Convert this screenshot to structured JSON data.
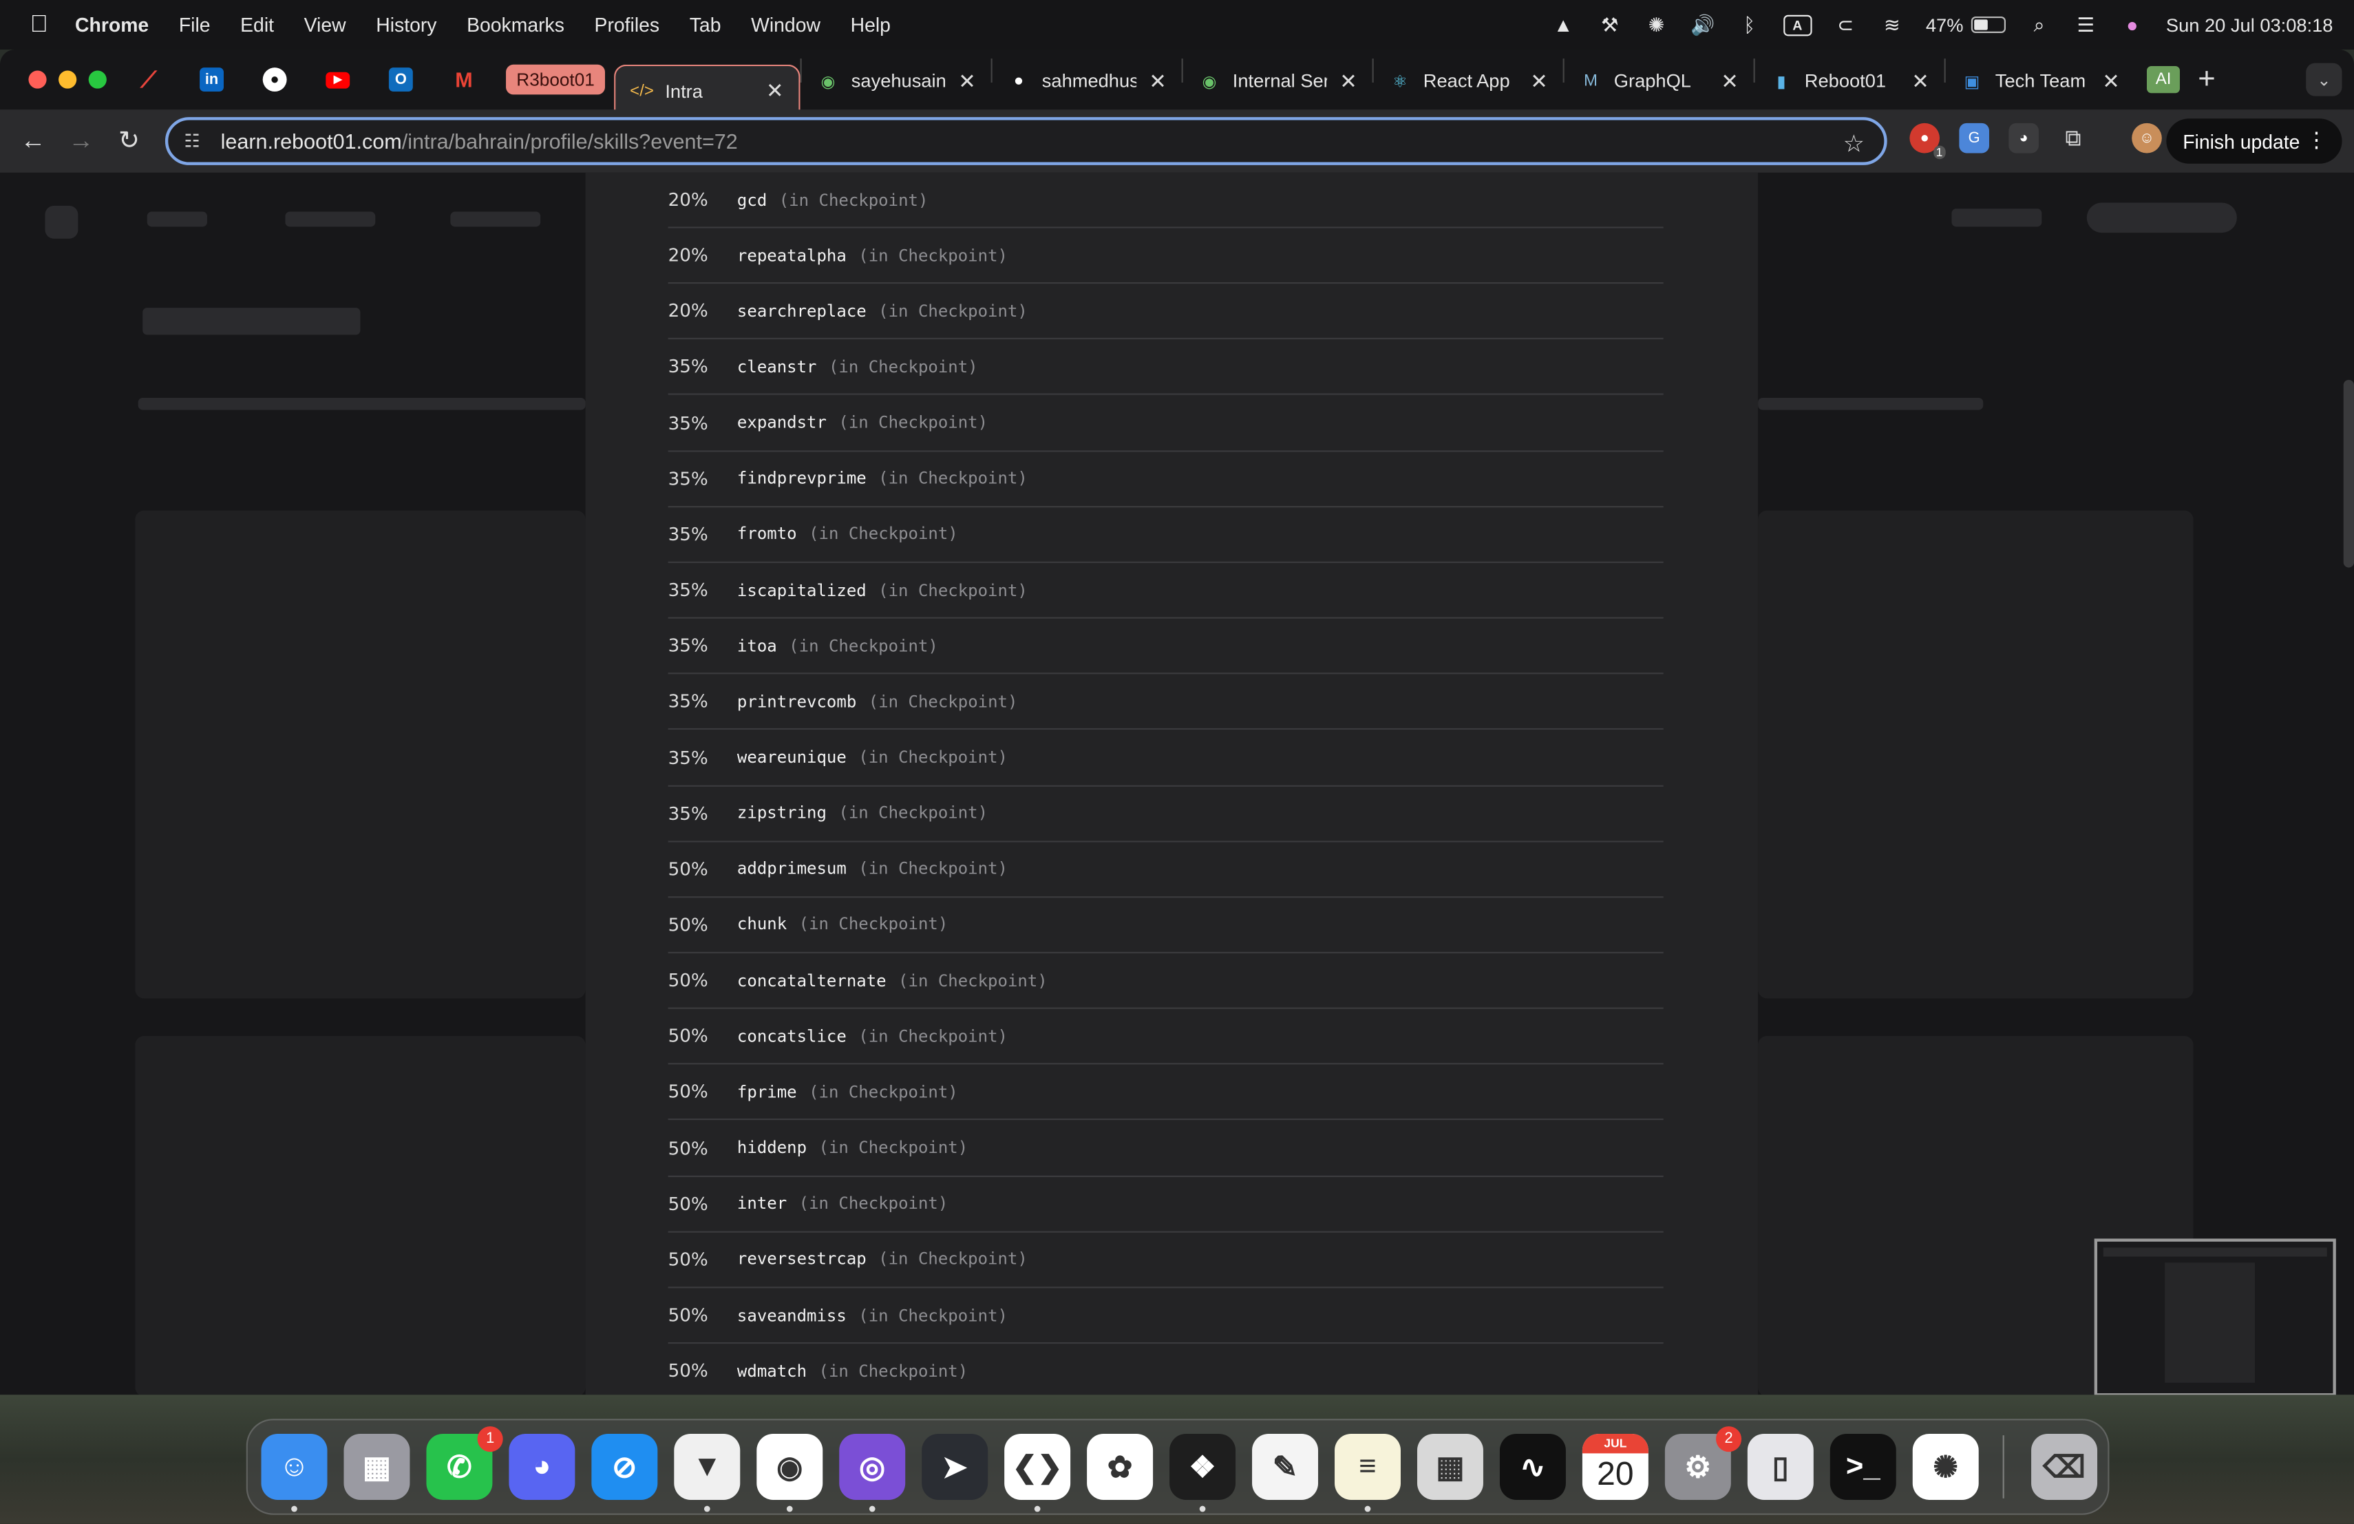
{
  "menubar": {
    "app_name": "Chrome",
    "items": [
      "File",
      "Edit",
      "View",
      "History",
      "Bookmarks",
      "Profiles",
      "Tab",
      "Window",
      "Help"
    ],
    "status": {
      "keyboard_label": "A",
      "battery_percent": "47%",
      "battery_level": 0.47,
      "datetime": "Sun 20 Jul  03:08:18"
    }
  },
  "tabs": {
    "group_label": "R3boot01",
    "items": [
      {
        "title": "Intra",
        "icon": "code-icon",
        "active": true,
        "width": 124
      },
      {
        "title": "sayehusain/",
        "icon": "watcher-icon",
        "width": 126
      },
      {
        "title": "sahmedhuss",
        "icon": "github-icon",
        "width": 126
      },
      {
        "title": "Internal Serv",
        "icon": "watcher-icon",
        "width": 126
      },
      {
        "title": "React App",
        "icon": "react-icon",
        "width": 126
      },
      {
        "title": "GraphQL",
        "icon": "graphql-icon",
        "width": 126
      },
      {
        "title": "Reboot01",
        "icon": "reboot-icon",
        "width": 126
      },
      {
        "title": "Tech Team A",
        "icon": "outlook-icon",
        "width": 126
      }
    ],
    "ai_label": "AI"
  },
  "toolbar": {
    "url_host": "learn.reboot01.com",
    "url_path": "/intra/bahrain/profile/skills?event=72",
    "ext_badge": "1",
    "finish_update": "Finish update"
  },
  "skills": [
    {
      "percent": "20%",
      "name": "gcd",
      "context": "(in Checkpoint)"
    },
    {
      "percent": "20%",
      "name": "repeatalpha",
      "context": "(in Checkpoint)"
    },
    {
      "percent": "20%",
      "name": "searchreplace",
      "context": "(in Checkpoint)"
    },
    {
      "percent": "35%",
      "name": "cleanstr",
      "context": "(in Checkpoint)"
    },
    {
      "percent": "35%",
      "name": "expandstr",
      "context": "(in Checkpoint)"
    },
    {
      "percent": "35%",
      "name": "findprevprime",
      "context": "(in Checkpoint)"
    },
    {
      "percent": "35%",
      "name": "fromto",
      "context": "(in Checkpoint)"
    },
    {
      "percent": "35%",
      "name": "iscapitalized",
      "context": "(in Checkpoint)"
    },
    {
      "percent": "35%",
      "name": "itoa",
      "context": "(in Checkpoint)"
    },
    {
      "percent": "35%",
      "name": "printrevcomb",
      "context": "(in Checkpoint)"
    },
    {
      "percent": "35%",
      "name": "weareunique",
      "context": "(in Checkpoint)"
    },
    {
      "percent": "35%",
      "name": "zipstring",
      "context": "(in Checkpoint)"
    },
    {
      "percent": "50%",
      "name": "addprimesum",
      "context": "(in Checkpoint)"
    },
    {
      "percent": "50%",
      "name": "chunk",
      "context": "(in Checkpoint)"
    },
    {
      "percent": "50%",
      "name": "concatalternate",
      "context": "(in Checkpoint)"
    },
    {
      "percent": "50%",
      "name": "concatslice",
      "context": "(in Checkpoint)"
    },
    {
      "percent": "50%",
      "name": "fprime",
      "context": "(in Checkpoint)"
    },
    {
      "percent": "50%",
      "name": "hiddenp",
      "context": "(in Checkpoint)"
    },
    {
      "percent": "50%",
      "name": "inter",
      "context": "(in Checkpoint)"
    },
    {
      "percent": "50%",
      "name": "reversestrcap",
      "context": "(in Checkpoint)"
    },
    {
      "percent": "50%",
      "name": "saveandmiss",
      "context": "(in Checkpoint)"
    },
    {
      "percent": "50%",
      "name": "wdmatch",
      "context": "(in Checkpoint)"
    }
  ],
  "dock": {
    "apps": [
      {
        "name": "finder",
        "icon": "finder-icon",
        "color": "#3a8ef0",
        "glyph": "☺",
        "running": true
      },
      {
        "name": "launchpad",
        "icon": "launchpad-icon",
        "color": "#9a9aa2",
        "glyph": "▦",
        "running": false
      },
      {
        "name": "whatsapp",
        "icon": "whatsapp-icon",
        "color": "#27c24c",
        "glyph": "✆",
        "badge": "1",
        "running": false
      },
      {
        "name": "discord",
        "icon": "discord-icon",
        "color": "#5865f2",
        "glyph": "◕",
        "running": false
      },
      {
        "name": "safari",
        "icon": "safari-icon",
        "color": "#1f8ef1",
        "glyph": "⊘",
        "running": false
      },
      {
        "name": "brave",
        "icon": "brave-icon",
        "color": "#f0f0f0",
        "glyph": "▼",
        "running": true
      },
      {
        "name": "chrome",
        "icon": "chrome-icon",
        "color": "#ffffff",
        "glyph": "◉",
        "running": true
      },
      {
        "name": "github-desktop",
        "icon": "github-desktop-icon",
        "color": "#7b4fd6",
        "glyph": "◎",
        "running": true
      },
      {
        "name": "send",
        "icon": "send-icon",
        "color": "#2a2d33",
        "glyph": "➤",
        "running": false
      },
      {
        "name": "vscode",
        "icon": "vscode-icon",
        "color": "#ffffff",
        "glyph": "❮❯",
        "running": true
      },
      {
        "name": "photos",
        "icon": "photos-icon",
        "color": "#ffffff",
        "glyph": "✿",
        "running": false
      },
      {
        "name": "figma",
        "icon": "figma-icon",
        "color": "#1e1e1e",
        "glyph": "❖",
        "running": true
      },
      {
        "name": "freeform",
        "icon": "freeform-icon",
        "color": "#f4f4f4",
        "glyph": "✎",
        "running": false
      },
      {
        "name": "notes",
        "icon": "notes-icon",
        "color": "#f7f3da",
        "glyph": "≡",
        "running": true
      },
      {
        "name": "calculator",
        "icon": "calculator-icon",
        "color": "#d8d8d8",
        "glyph": "▦",
        "running": false
      },
      {
        "name": "activity-monitor",
        "icon": "activity-monitor-icon",
        "color": "#111111",
        "glyph": "∿",
        "running": false
      },
      {
        "name": "calendar",
        "icon": "calendar-icon",
        "color": "#ffffff",
        "glyph": "20",
        "calendar_month": "JUL",
        "running": false
      },
      {
        "name": "system-settings",
        "icon": "settings-icon",
        "color": "#8e8e93",
        "glyph": "⚙",
        "badge": "2",
        "running": false
      },
      {
        "name": "iphone-mirroring",
        "icon": "iphone-icon",
        "color": "#e6e6ea",
        "glyph": "▯",
        "running": false
      },
      {
        "name": "terminal",
        "icon": "terminal-icon",
        "color": "#111111",
        "glyph": ">_",
        "running": false
      },
      {
        "name": "chatgpt",
        "icon": "chatgpt-icon",
        "color": "#ffffff",
        "glyph": "✺",
        "running": false
      },
      {
        "name": "trash",
        "icon": "trash-icon",
        "color": "#b9b9bd",
        "glyph": "⌫",
        "running": false
      }
    ]
  }
}
